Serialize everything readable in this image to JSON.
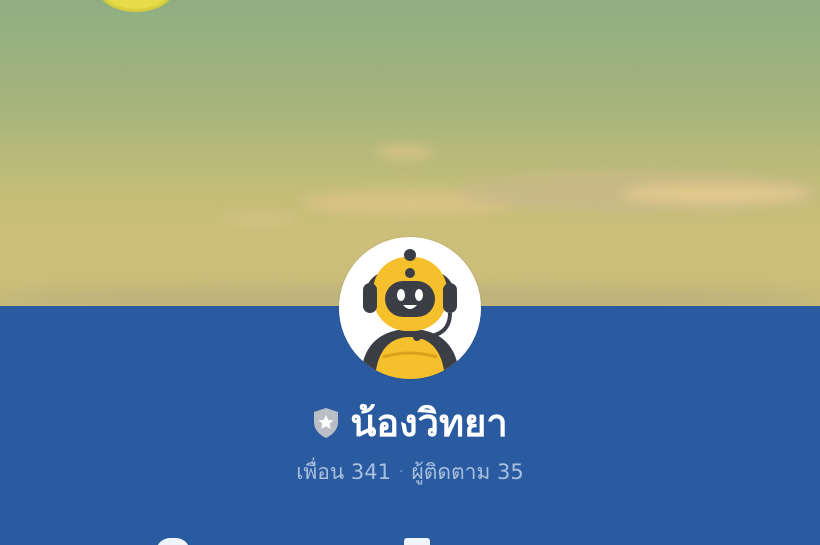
{
  "cover": {
    "icon": "sky-cover-image"
  },
  "profile": {
    "avatar_icon": "robot-headset-avatar",
    "badge_icon": "verified-shield-star-icon",
    "name": "น้องวิทยา",
    "friends_label": "เพื่อน",
    "friends_count": "341",
    "separator": "·",
    "followers_label": "ผู้ติดตาม",
    "followers_count": "35"
  },
  "actions": {
    "left_icon": "chat-icon",
    "right_icon": "post-icon"
  },
  "colors": {
    "band": "#2a5a9f",
    "name_text": "#ffffff",
    "stats_text": "#a9c0df",
    "avatar_yellow": "#f6c02c",
    "avatar_dark": "#3b3e45",
    "badge_gray": "#b9bec7"
  }
}
